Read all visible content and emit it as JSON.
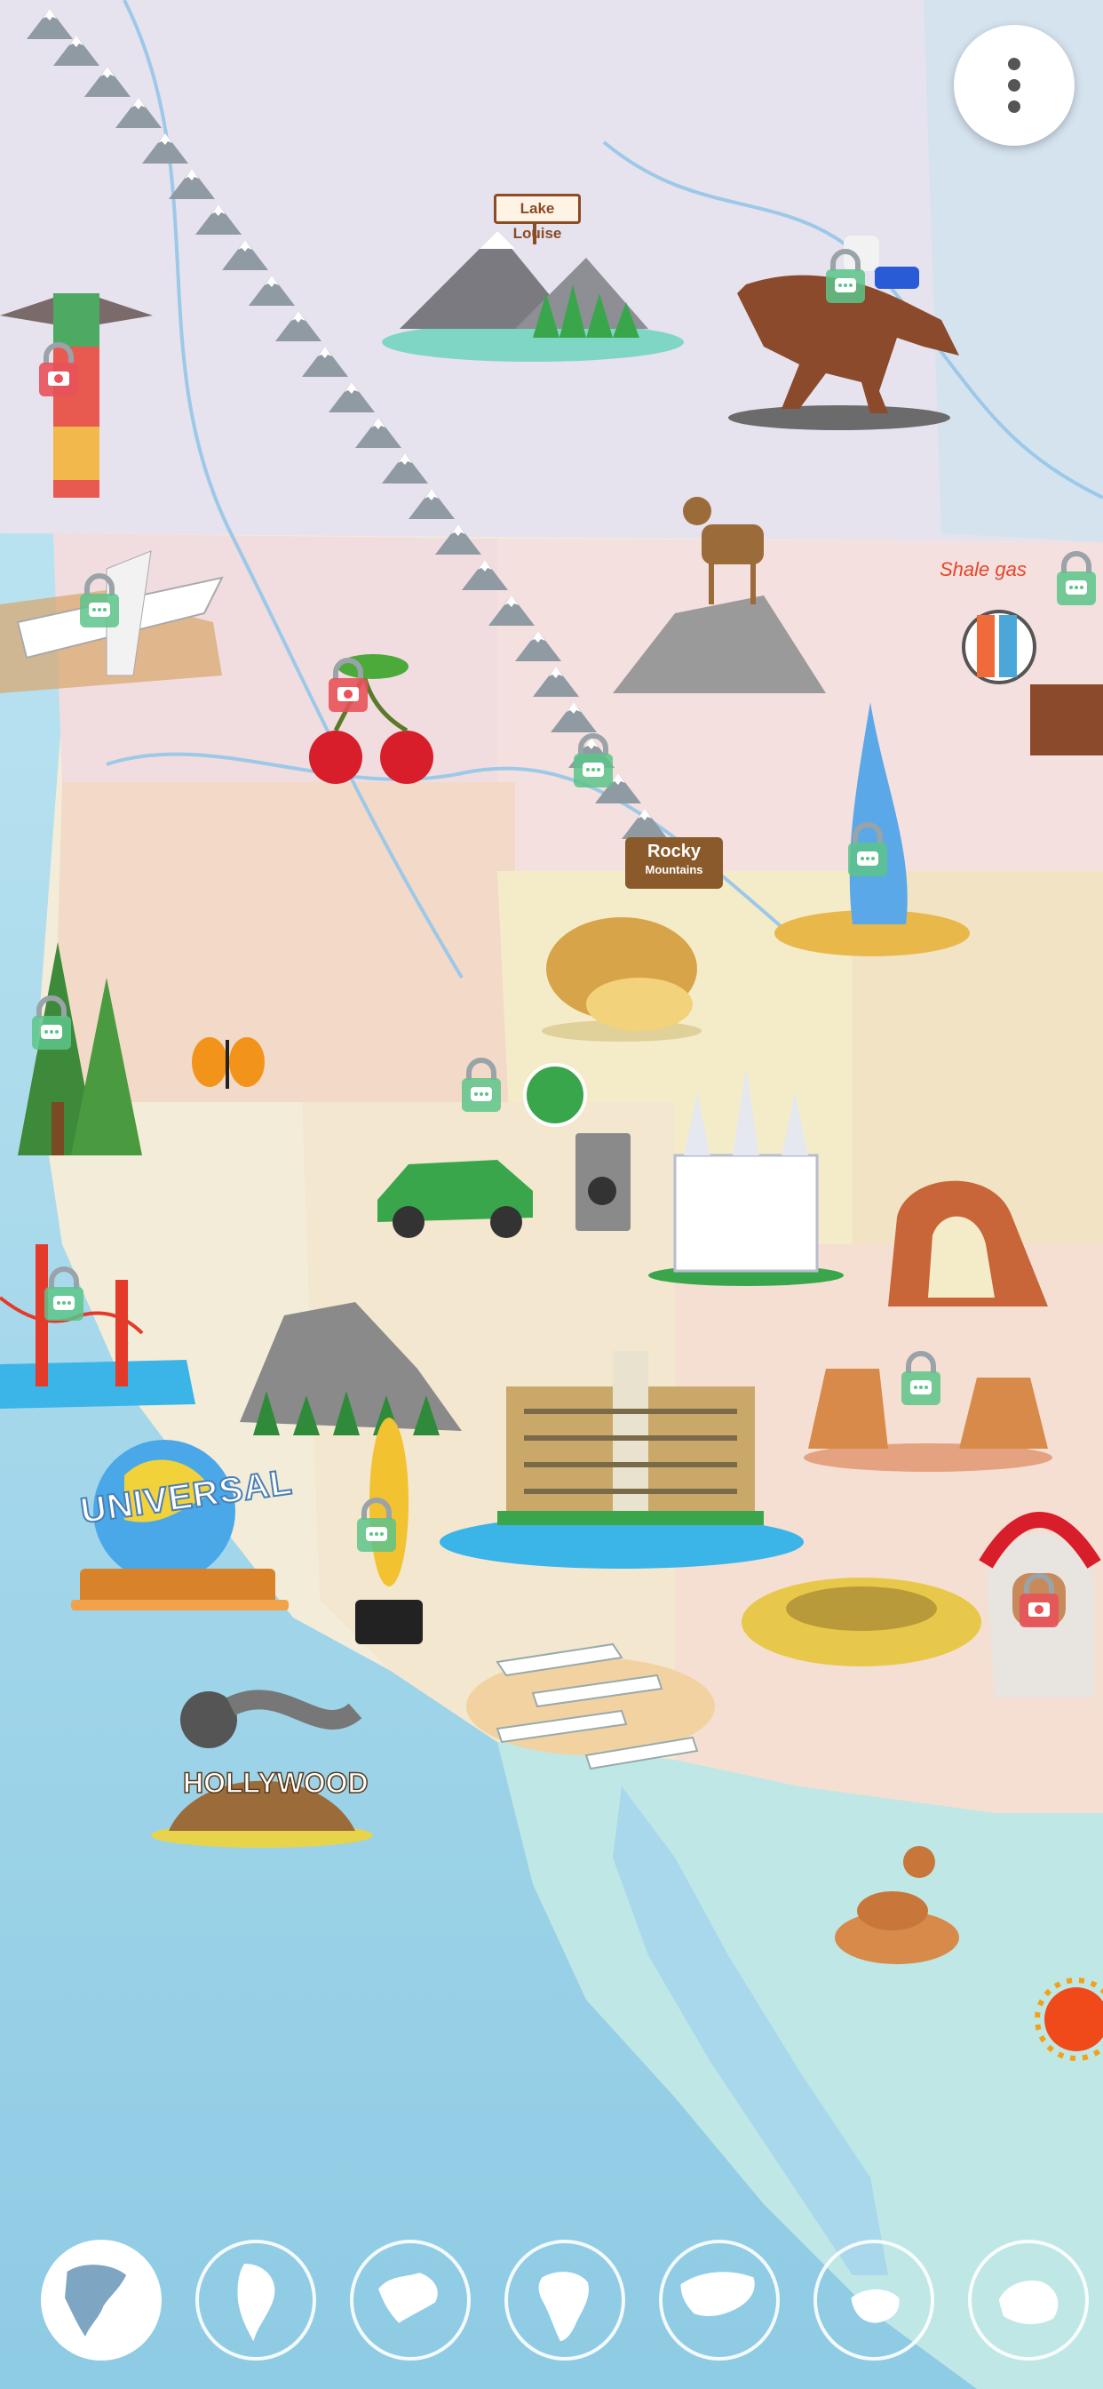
{
  "labels": {
    "lake_louise": "Lake Louise",
    "rocky_title": "Rocky",
    "rocky_sub": "Mountains",
    "shale_gas": "Shale gas",
    "universal": "UNIVERSAL",
    "hollywood": "HOLLYWOOD"
  },
  "menu": {
    "icon": "more-vertical-icon"
  },
  "landmarks": [
    {
      "name": "totem-pole",
      "lock": "camera-lock"
    },
    {
      "name": "airplane-factory",
      "lock": "chat-lock"
    },
    {
      "name": "lake-louise",
      "lock": "none"
    },
    {
      "name": "rodeo-horse",
      "lock": "chat-lock"
    },
    {
      "name": "bighorn-sheep",
      "lock": "none"
    },
    {
      "name": "shale-gas",
      "lock": "chat-lock"
    },
    {
      "name": "cherries",
      "lock": "camera-lock"
    },
    {
      "name": "rocky-mountains",
      "lock": "chat-lock"
    },
    {
      "name": "geyser",
      "lock": "chat-lock"
    },
    {
      "name": "potato",
      "lock": "none"
    },
    {
      "name": "redwood-tree",
      "lock": "chat-lock"
    },
    {
      "name": "monarch-butterfly",
      "lock": "none"
    },
    {
      "name": "electric-car",
      "lock": "chat-lock"
    },
    {
      "name": "salt-lake-temple",
      "lock": "none"
    },
    {
      "name": "delicate-arch",
      "lock": "none"
    },
    {
      "name": "golden-gate-bridge",
      "lock": "chat-lock"
    },
    {
      "name": "half-dome",
      "lock": "none"
    },
    {
      "name": "bellagio",
      "lock": "none"
    },
    {
      "name": "monument-valley",
      "lock": "chat-lock"
    },
    {
      "name": "universal-studios",
      "lock": "none"
    },
    {
      "name": "oscar-statue",
      "lock": "chat-lock"
    },
    {
      "name": "native-american-chief",
      "lock": "camera-lock"
    },
    {
      "name": "meteor-crater",
      "lock": "none"
    },
    {
      "name": "airplane-boneyard",
      "lock": "none"
    },
    {
      "name": "hollywood-sign",
      "lock": "none"
    },
    {
      "name": "rattlesnake",
      "lock": "none"
    }
  ],
  "continents": [
    {
      "name": "north-america",
      "active": true
    },
    {
      "name": "south-america",
      "active": false
    },
    {
      "name": "europe",
      "active": false
    },
    {
      "name": "africa",
      "active": false
    },
    {
      "name": "asia",
      "active": false
    },
    {
      "name": "oceania",
      "active": false
    },
    {
      "name": "antarctica",
      "active": false
    }
  ],
  "colors": {
    "ocean": "#a9d8ec",
    "canada": "#e6e2ee",
    "lock_green": "#5cc48a",
    "lock_red": "#e8525a",
    "mountain_snow": "#ffffff",
    "mountain_rock": "#8f9aa3"
  }
}
